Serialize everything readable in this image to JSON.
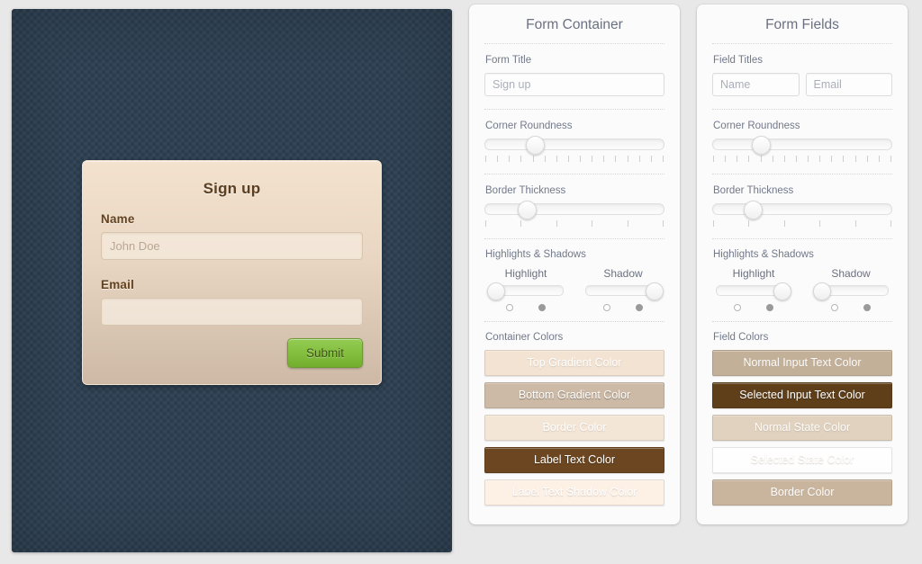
{
  "preview": {
    "background_color": "#2c3e50",
    "form": {
      "title": "Sign up",
      "fields": [
        {
          "label": "Name",
          "placeholder": "John Doe",
          "value": ""
        },
        {
          "label": "Email",
          "placeholder": "",
          "value": ""
        }
      ],
      "submit_label": "Submit",
      "submit_color": "#84bf40",
      "top_gradient_color": "#f3e2ce",
      "bottom_gradient_color": "#cdb9a5",
      "border_color": "#f0e2d2",
      "label_text_color": "#64421f"
    }
  },
  "panels": [
    {
      "id": "form-container",
      "title": "Form Container",
      "form_title": {
        "label": "Form Title",
        "placeholder": "Sign up",
        "value": ""
      },
      "corner_roundness": {
        "label": "Corner Roundness",
        "position_pct": 28,
        "tick_count": 16
      },
      "border_thickness": {
        "label": "Border Thickness",
        "position_pct": 23,
        "tick_count": 6
      },
      "highlights_shadows": {
        "label": "Highlights & Shadows",
        "controls": [
          {
            "label": "Highlight",
            "position_pct": 8,
            "radio_left_on": false,
            "radio_right_on": true
          },
          {
            "label": "Shadow",
            "position_pct": 92,
            "radio_left_on": false,
            "radio_right_on": true
          }
        ]
      },
      "colors": {
        "label": "Container Colors",
        "swatches": [
          {
            "label": "Top Gradient Color",
            "color": "#f3e3d2",
            "text_style": "ghost-text"
          },
          {
            "label": "Bottom Gradient Color",
            "color": "#cdbaa6",
            "text_style": "light-text"
          },
          {
            "label": "Border Color",
            "color": "#f4e6d6",
            "text_style": "ghost-text"
          },
          {
            "label": "Label Text Color",
            "color": "#6b4620",
            "text_style": "light-text"
          },
          {
            "label": "Label Text Shadow Color",
            "color": "#fdf1e6",
            "text_style": "ghost-text"
          }
        ]
      }
    },
    {
      "id": "form-fields",
      "title": "Form Fields",
      "field_titles": {
        "label": "Field Titles",
        "inputs": [
          {
            "placeholder": "Name",
            "value": ""
          },
          {
            "placeholder": "Email",
            "value": ""
          }
        ]
      },
      "corner_roundness": {
        "label": "Corner Roundness",
        "position_pct": 27,
        "tick_count": 16
      },
      "border_thickness": {
        "label": "Border Thickness",
        "position_pct": 22,
        "tick_count": 6
      },
      "highlights_shadows": {
        "label": "Highlights & Shadows",
        "controls": [
          {
            "label": "Highlight",
            "position_pct": 88,
            "radio_left_on": false,
            "radio_right_on": true
          },
          {
            "label": "Shadow",
            "position_pct": 10,
            "radio_left_on": false,
            "radio_right_on": true
          }
        ]
      },
      "colors": {
        "label": "Field Colors",
        "swatches": [
          {
            "label": "Normal Input Text Color",
            "color": "#c3b099",
            "text_style": "pale-text"
          },
          {
            "label": "Selected Input Text Color",
            "color": "#5f3f1a",
            "text_style": "light-text"
          },
          {
            "label": "Normal State Color",
            "color": "#e0d2bf",
            "text_style": "pale-text"
          },
          {
            "label": "Selected State Color",
            "color": "#fefefe",
            "text_style": "ghost-text"
          },
          {
            "label": "Border Color",
            "color": "#c9b59e",
            "text_style": "pale-text"
          }
        ]
      }
    }
  ]
}
